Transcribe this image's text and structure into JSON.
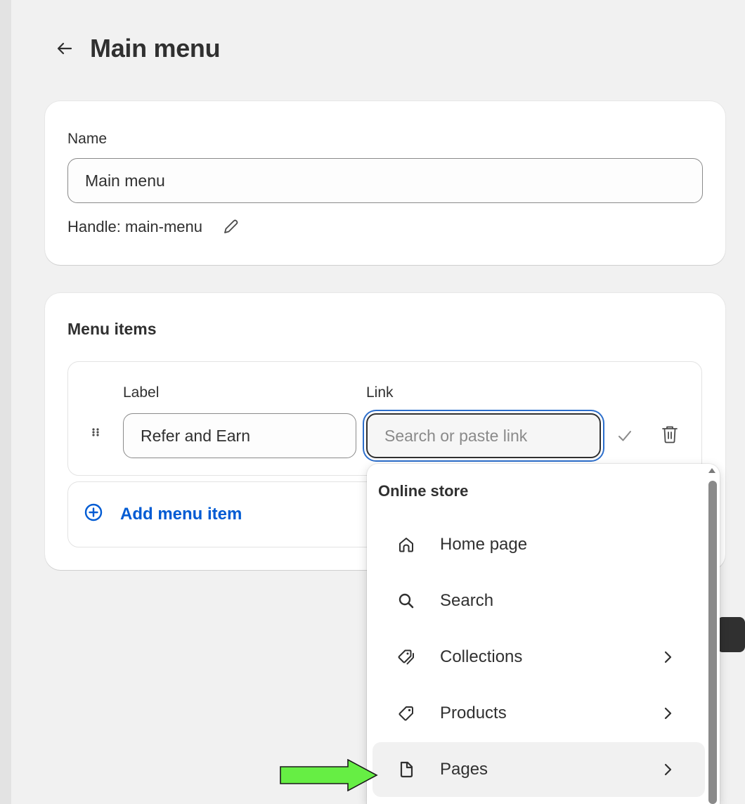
{
  "header": {
    "back_icon": "arrow-left-icon",
    "title": "Main menu"
  },
  "name_card": {
    "name_label": "Name",
    "name_value": "Main menu",
    "handle_text": "Handle: main-menu",
    "edit_icon": "pencil-icon"
  },
  "menu_card": {
    "title": "Menu items",
    "item": {
      "label_header": "Label",
      "link_header": "Link",
      "label_value": "Refer and Earn",
      "link_placeholder": "Search or paste link",
      "drag_icon": "drag-handle-icon",
      "confirm_icon": "checkmark-icon",
      "delete_icon": "trash-icon"
    },
    "add_label": "Add menu item",
    "add_icon": "plus-circle-icon"
  },
  "dropdown": {
    "section_title": "Online store",
    "items": [
      {
        "label": "Home page",
        "icon": "home-icon",
        "has_submenu": false
      },
      {
        "label": "Search",
        "icon": "search-icon",
        "has_submenu": false
      },
      {
        "label": "Collections",
        "icon": "collections-tag-icon",
        "has_submenu": true
      },
      {
        "label": "Products",
        "icon": "tag-icon",
        "has_submenu": true
      },
      {
        "label": "Pages",
        "icon": "page-icon",
        "has_submenu": true
      }
    ],
    "selected_index": 4
  },
  "annotation": {
    "arrow_color": "#66ee44"
  },
  "colors": {
    "accent": "#005bd3",
    "focus_ring": "#2c6ecb",
    "background": "#f1f1f1"
  }
}
